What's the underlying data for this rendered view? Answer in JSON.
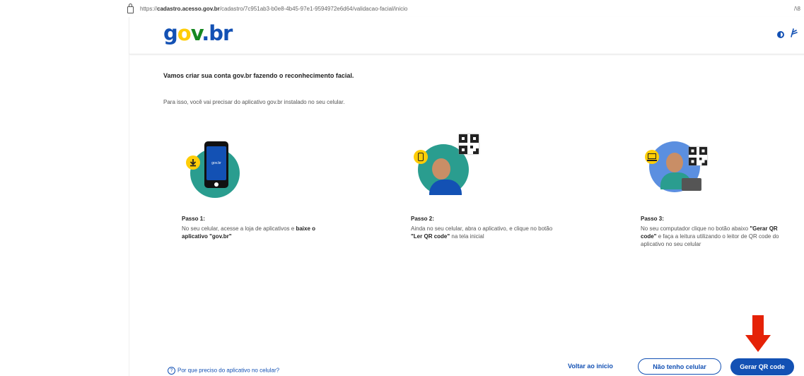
{
  "browser": {
    "url_prefix": "https://",
    "url_host": "cadastro.acesso.gov.br",
    "url_path": "/cadastro/7c951ab3-b0e8-4b45-97e1-9594972e6d64/validacao-facial/inicio",
    "right_fragment": "/\\8"
  },
  "header": {
    "logo": {
      "g": "g",
      "o": "o",
      "v": "v",
      "dot": ".",
      "br": "br"
    },
    "icons": [
      "contrast-icon",
      "vlibras-icon"
    ]
  },
  "intro": {
    "title": "Vamos criar sua conta gov.br fazendo o reconhecimento facial.",
    "subtitle": "Para isso, você vai precisar do aplicativo gov.br instalado no seu celular."
  },
  "steps": [
    {
      "label": "Passo 1:",
      "text_before": "No seu celular, acesse a loja de aplicativos e ",
      "bold": "baixe o aplicativo \"gov.br\"",
      "text_after": "",
      "phone_brand": "gov.br"
    },
    {
      "label": "Passo 2:",
      "text_before": "Ainda no seu celular, abra o aplicativo, e clique no botão ",
      "bold": "\"Ler QR code\"",
      "text_after": " na tela inicial"
    },
    {
      "label": "Passo 3:",
      "text_before": "No seu computador clique no botão abaixo ",
      "bold": "\"Gerar QR code\"",
      "text_after": " e faça a leitura utilizando o leitor de QR code do aplicativo no seu celular"
    }
  ],
  "footer": {
    "help_icon": "?",
    "help_link": "Por que preciso do aplicativo no celular?",
    "back_button": "Voltar ao início",
    "no_phone_button": "Não tenho celular",
    "generate_button": "Gerar QR code"
  },
  "colors": {
    "brand_blue": "#1351b4",
    "teal": "#2a9d8f",
    "yellow": "#ffcd07",
    "arrow_red": "#e52207"
  }
}
